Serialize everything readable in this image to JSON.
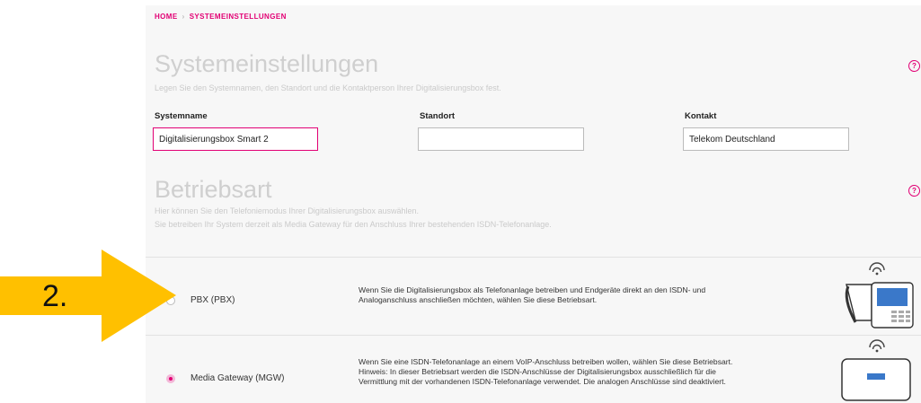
{
  "breadcrumb": {
    "home": "HOME",
    "separator": "›",
    "current": "SYSTEMEINSTELLUNGEN"
  },
  "system": {
    "title": "Systemeinstellungen",
    "subtitle": "Legen Sie den Systemnamen, den Standort und die Kontaktperson Ihrer Digitalisierungsbox fest.",
    "fields": {
      "systemname": {
        "label": "Systemname",
        "value": "Digitalisierungsbox Smart 2"
      },
      "standort": {
        "label": "Standort",
        "value": ""
      },
      "kontakt": {
        "label": "Kontakt",
        "value": "Telekom Deutschland"
      }
    }
  },
  "betriebsart": {
    "title": "Betriebsart",
    "subtitle_1": "Hier können Sie den Telefoniemodus Ihrer Digitalisierungsbox auswählen.",
    "subtitle_2": "Sie betreiben Ihr System derzeit als Media Gateway für den Anschluss Ihrer bestehenden ISDN-Telefonanlage.",
    "options": [
      {
        "label": "PBX (PBX)",
        "selected": false,
        "desc_lines": [
          "Wenn Sie die Digitalisierungsbox als Telefonanlage betreiben und Endgeräte direkt an den ISDN- und",
          "Analoganschluss anschließen möchten, wählen Sie diese Betriebsart."
        ],
        "icon": "phone-system-icon"
      },
      {
        "label": "Media Gateway (MGW)",
        "selected": true,
        "desc_lines": [
          "Wenn Sie eine ISDN-Telefonanlage an einem VoIP-Anschluss betreiben wollen, wählen Sie diese Betriebsart.",
          "Hinweis: In dieser Betriebsart werden die ISDN-Anschlüsse der Digitalisierungsbox ausschließlich für die",
          "Vermittlung mit der vorhandenen ISDN-Telefonanlage verwendet. Die analogen Anschlüsse sind deaktiviert."
        ],
        "icon": "router-icon"
      }
    ]
  },
  "help_icon": "?",
  "annotation": {
    "step": "2."
  },
  "colors": {
    "accent": "#e20074",
    "arrow": "#ffc000"
  }
}
